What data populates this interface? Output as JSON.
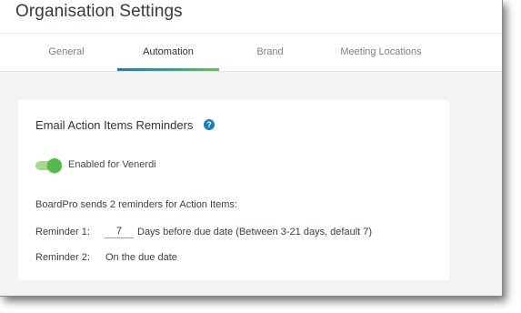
{
  "page": {
    "title": "Organisation Settings"
  },
  "tabs": [
    {
      "label": "General",
      "active": false
    },
    {
      "label": "Automation",
      "active": true
    },
    {
      "label": "Brand",
      "active": false
    },
    {
      "label": "Meeting Locations",
      "active": false
    }
  ],
  "card": {
    "title": "Email Action Items Reminders",
    "help_icon": "question-circle-icon",
    "toggle": {
      "enabled": true,
      "label": "Enabled for Venerdi"
    },
    "reminders_heading": "BoardPro sends 2 reminders for Action Items:",
    "reminder1": {
      "label": "Reminder 1:",
      "value": "7",
      "suffix": "Days before due date (Between 3-21 days, default 7)"
    },
    "reminder2": {
      "label": "Reminder 2:",
      "text": "On the due date"
    }
  },
  "colors": {
    "accent_gradient_start": "#1f7fa6",
    "accent_gradient_end": "#6cc04a",
    "toggle_on": "#56b947",
    "help_icon": "#1d7fb0",
    "page_background": "#f2f3f4"
  }
}
